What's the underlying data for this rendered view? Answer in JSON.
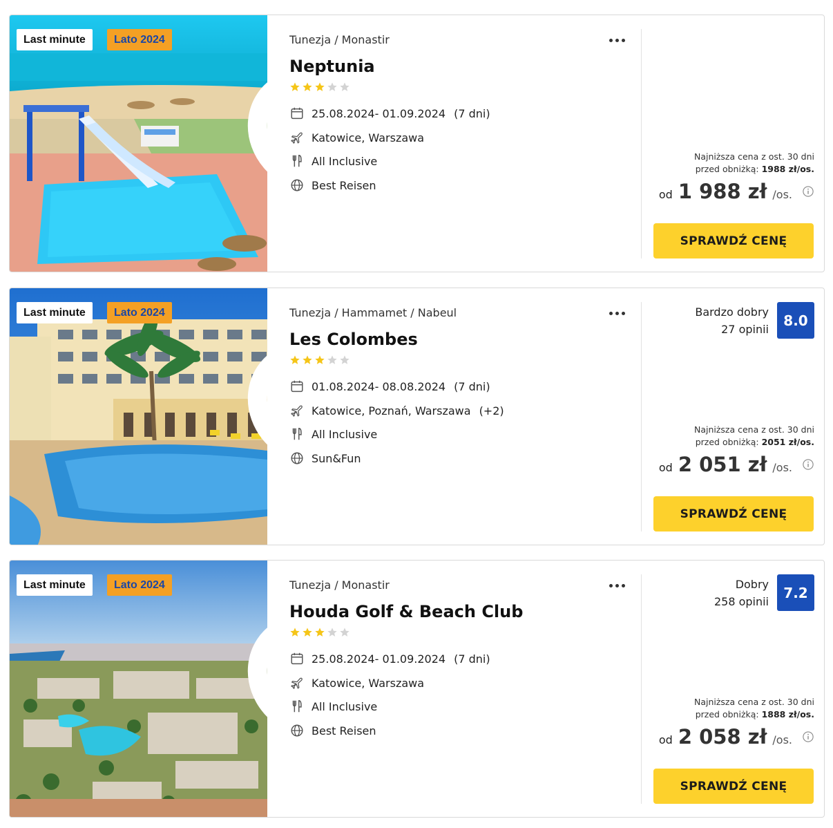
{
  "offers": [
    {
      "badges": {
        "last_minute": "Last minute",
        "season": "Lato 2024"
      },
      "location": "Tunezja / Monastir",
      "name": "Neptunia",
      "stars": 3,
      "max_stars": 5,
      "dates": "25.08.2024- 01.09.2024",
      "duration": "(7 dni)",
      "departures": "Katowice, Warszawa",
      "departures_extra": "",
      "board": "All Inclusive",
      "operator": "Best Reisen",
      "rating_label": "",
      "reviews": "",
      "rating_score": "",
      "lowest_price_line1": "Najniższa cena z ost. 30 dni",
      "lowest_price_prefix": "przed obniżką: ",
      "lowest_price_value": "1988 zł/os.",
      "price_from": "od",
      "price": "1 988 zł",
      "price_per": "/os.",
      "button_label": "SPRAWDŹ CENĘ"
    },
    {
      "badges": {
        "last_minute": "Last minute",
        "season": "Lato 2024"
      },
      "location": "Tunezja / Hammamet / Nabeul",
      "name": "Les Colombes",
      "stars": 3,
      "max_stars": 5,
      "dates": "01.08.2024- 08.08.2024",
      "duration": "(7 dni)",
      "departures": "Katowice, Poznań, Warszawa",
      "departures_extra": "(+2)",
      "board": "All Inclusive",
      "operator": "Sun&Fun",
      "rating_label": "Bardzo dobry",
      "reviews": "27 opinii",
      "rating_score": "8.0",
      "lowest_price_line1": "Najniższa cena z ost. 30 dni",
      "lowest_price_prefix": "przed obniżką: ",
      "lowest_price_value": "2051 zł/os.",
      "price_from": "od",
      "price": "2 051 zł",
      "price_per": "/os.",
      "button_label": "SPRAWDŹ CENĘ"
    },
    {
      "badges": {
        "last_minute": "Last minute",
        "season": "Lato 2024"
      },
      "location": "Tunezja / Monastir",
      "name": "Houda Golf & Beach Club",
      "stars": 3,
      "max_stars": 5,
      "dates": "25.08.2024- 01.09.2024",
      "duration": "(7 dni)",
      "departures": "Katowice, Warszawa",
      "departures_extra": "",
      "board": "All Inclusive",
      "operator": "Best Reisen",
      "rating_label": "Dobry",
      "reviews": "258 opinii",
      "rating_score": "7.2",
      "lowest_price_line1": "Najniższa cena z ost. 30 dni",
      "lowest_price_prefix": "przed obniżką: ",
      "lowest_price_value": "1888 zł/os.",
      "price_from": "od",
      "price": "2 058 zł",
      "price_per": "/os.",
      "button_label": "SPRAWDŹ CENĘ"
    }
  ],
  "colors": {
    "button": "#fdd12c",
    "season_badge": "#f4a024",
    "rating_badge": "#1a4fb8",
    "star_filled": "#f5c518",
    "star_empty": "#d3d3d3"
  },
  "icons": [
    "heart-icon",
    "more-options-icon",
    "calendar-icon",
    "plane-icon",
    "cutlery-icon",
    "globe-icon",
    "info-icon",
    "star-icon"
  ]
}
